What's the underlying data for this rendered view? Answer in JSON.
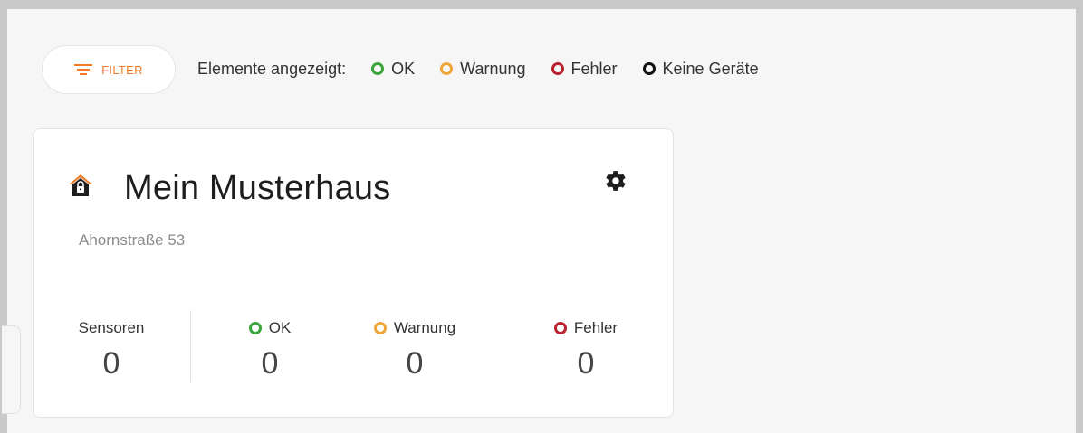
{
  "toolbar": {
    "filter_label": "FILTER",
    "legend_title": "Elemente angezeigt:",
    "legend": [
      {
        "label": "OK",
        "color": "#3aa53a"
      },
      {
        "label": "Warnung",
        "color": "#f0a43a"
      },
      {
        "label": "Fehler",
        "color": "#b8232f"
      },
      {
        "label": "Keine Geräte",
        "color": "#111111"
      }
    ]
  },
  "card": {
    "title": "Mein Musterhaus",
    "address": "Ahornstraße 53",
    "icon_color": "#f07c2a",
    "stats": [
      {
        "label": "Sensoren",
        "value": "0"
      },
      {
        "label": "OK",
        "value": "0",
        "color": "#3aa53a"
      },
      {
        "label": "Warnung",
        "value": "0",
        "color": "#f0a43a"
      },
      {
        "label": "Fehler",
        "value": "0",
        "color": "#b8232f"
      }
    ]
  }
}
